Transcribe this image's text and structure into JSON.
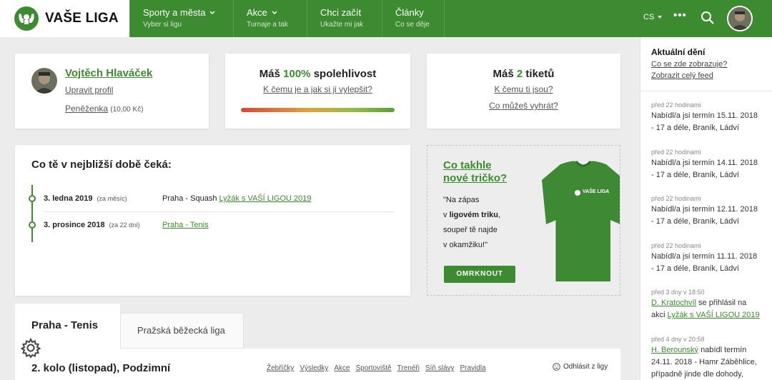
{
  "brand": {
    "name": "VAŠE LIGA"
  },
  "nav": [
    {
      "title": "Sporty a města",
      "subtitle": "Vyber si ligu",
      "has_dropdown": true
    },
    {
      "title": "Akce",
      "subtitle": "Turnaje a tak",
      "has_dropdown": true
    },
    {
      "title": "Chci začít",
      "subtitle": "Ukažte mi jak",
      "has_dropdown": false
    },
    {
      "title": "Články",
      "subtitle": "Co se děje",
      "has_dropdown": false
    }
  ],
  "header": {
    "lang": "CS",
    "more": "•••"
  },
  "profile": {
    "name": "Vojtěch Hlaváček",
    "edit": "Upravit profil",
    "wallet_label": "Peněženka",
    "wallet_amount": "(10,00 Kč)"
  },
  "reliability": {
    "prefix": "Máš",
    "value": "100%",
    "suffix": "spolehlivost",
    "link": "K čemu je a jak si ji vylepšit?",
    "level": 1.0
  },
  "tickets": {
    "prefix": "Máš",
    "value": "2",
    "suffix": "tiketů",
    "link1": "K čemu ti jsou?",
    "link2": "Co můžeš vyhrát?"
  },
  "upcoming": {
    "title": "Co tě v nejbližší době čeká:",
    "items": [
      {
        "date": "3. ledna 2019",
        "rel": "(za měsíc)",
        "place": "Praha - Squash",
        "event": "Lyžák s VAŠÍ LIGOU 2019"
      },
      {
        "date": "3. prosince 2018",
        "rel": "(za 22 dní)",
        "place": "",
        "event": "Praha - Tenis"
      }
    ]
  },
  "promo": {
    "title_line1": "Co takhle",
    "title_line2": "nové tričko?",
    "q1": "\"Na zápas",
    "q2a": "v ",
    "q2b": "ligovém triku",
    "q2c": ",",
    "q3": "soupeř tě najde",
    "q4": "v okamžiku!\"",
    "button": "OMRKNOUT",
    "shirt_text": "VAŠE LIGA"
  },
  "tabs": {
    "active": "Praha - Tenis",
    "inactive": "Pražská běžecká liga"
  },
  "round": {
    "title": "2. kolo (listopad), Podzimní",
    "links": [
      "Žebříčky",
      "Výsledky",
      "Akce",
      "Sportoviště",
      "Trenéři",
      "Síň slávy",
      "Pravidla"
    ],
    "leave": "Odhlásit z ligy"
  },
  "feed": {
    "title": "Aktuální dění",
    "link1": "Co se zde zobrazuje?",
    "link2": "Zobrazit celý feed",
    "items": [
      {
        "time": "před 22 hodinami",
        "text": "Nabídl/a jsi termín 15.11. 2018 - 17 a déle, Braník, Ládví"
      },
      {
        "time": "před 22 hodinami",
        "text": "Nabídl/a jsi termín 14.11. 2018 - 17 a déle, Braník, Ládví"
      },
      {
        "time": "před 22 hodinami",
        "text": "Nabídl/a jsi termín 12.11. 2018 - 17 a déle, Braník, Ládví"
      },
      {
        "time": "před 22 hodinami",
        "text": "Nabídl/a jsi termín 11.11. 2018 - 17 a déle, Braník, Ládví"
      },
      {
        "time": "před 3 dny v 18:50",
        "user": "D. Kratochvíl",
        "text_mid": " se přihlásil na akci ",
        "link": "Lyžák s VAŠÍ LIGOU 2019"
      },
      {
        "time": "před 4 dny v 20:58",
        "user": "H. Berounský",
        "text_mid": " nabídl termín 24.11. 2018 - Hamr Záběhlice, případně jinde dle dohody,"
      }
    ]
  },
  "colors": {
    "brand_green": "#3d8b30",
    "link_green": "#3a8c2d",
    "background": "#ececec"
  }
}
